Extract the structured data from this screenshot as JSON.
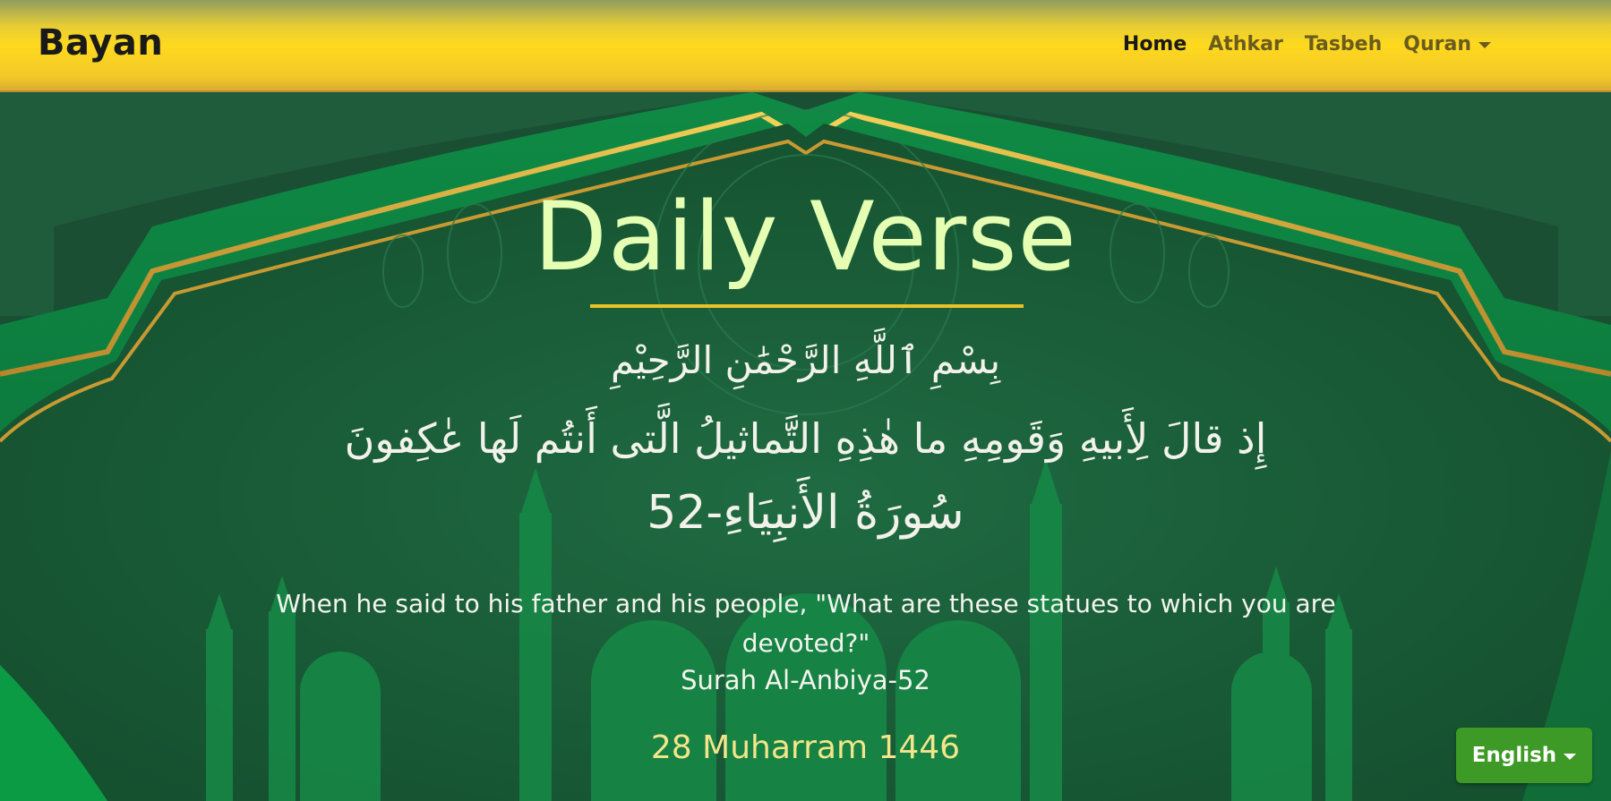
{
  "navbar": {
    "brand": "Bayan",
    "links": [
      "Home",
      "Athkar",
      "Tasbeh",
      "Quran"
    ],
    "active": "Home"
  },
  "hero": {
    "title": "Daily Verse",
    "bismillah": "بِسْمِ ٱللَّهِ الرَّحْمَٰنِ الرَّحِيْمِ",
    "verse_arabic": "إِذ قالَ لِأَبيهِ وَقَومِهِ ما هٰذِهِ التَّماثيلُ الَّتى أَنتُم لَها عٰكِفونَ",
    "surah_arabic": "سُورَةُ الأَنبِيَاءِ-52",
    "translation": "When he said to his father and his people, \"What are these statues to which you are devoted?\"",
    "surah_english": "Surah Al-Anbiya-52",
    "hijri_date": "28 Muharram 1446"
  },
  "language_button": {
    "label": "English"
  },
  "colors": {
    "nav_yellow": "#ffd91e",
    "hero_green": "#1d5b3a",
    "title_color": "#e5ffb3",
    "gold": "#e9c228",
    "button_green": "#3e9a26",
    "date_color": "#f5e58a"
  }
}
